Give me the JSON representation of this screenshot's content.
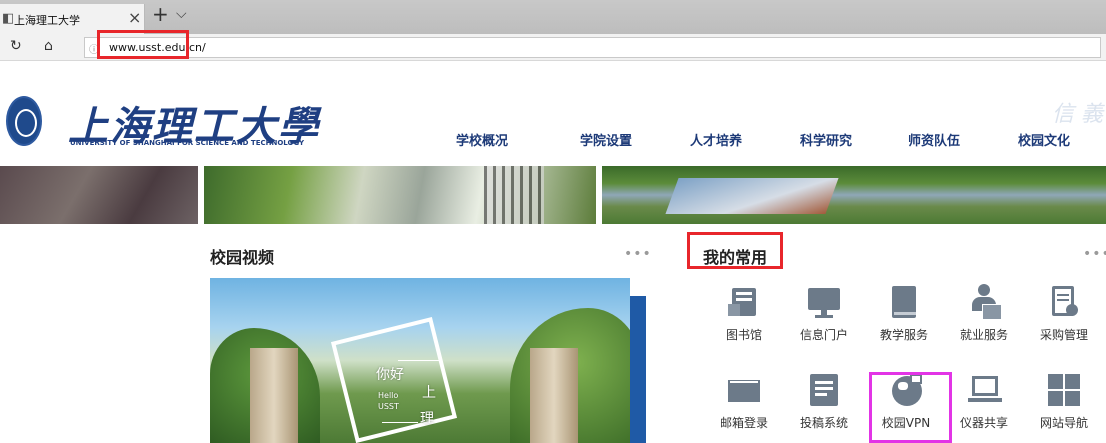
{
  "browser": {
    "tab_title": "上海理工大学",
    "url": "www.usst.edu.cn/"
  },
  "header": {
    "logo_cn": "上海理工大學",
    "logo_en": "UNIVERSITY OF SHANGHAI FOR SCIENCE AND TECHNOLOGY",
    "corner_text": "信 義",
    "nav": [
      "学校概况",
      "学院设置",
      "人才培养",
      "科学研究",
      "师资队伍",
      "校园文化"
    ]
  },
  "video_section": {
    "title": "校园视频",
    "more": "•••",
    "overlay": {
      "line1": "你好",
      "line2": "Hello",
      "line3": "USST",
      "line4": "上",
      "line5": "理"
    }
  },
  "favorites_section": {
    "title": "我的常用",
    "more": "•••",
    "items": [
      {
        "label": "图书馆",
        "icon": "library-icon"
      },
      {
        "label": "信息门户",
        "icon": "monitor-icon"
      },
      {
        "label": "教学服务",
        "icon": "book-icon"
      },
      {
        "label": "就业服务",
        "icon": "person-icon"
      },
      {
        "label": "采购管理",
        "icon": "document-gear-icon"
      },
      {
        "label": "邮箱登录",
        "icon": "envelope-icon"
      },
      {
        "label": "投稿系统",
        "icon": "form-icon"
      },
      {
        "label": "校园VPN",
        "icon": "globe-network-icon"
      },
      {
        "label": "仪器共享",
        "icon": "laptop-icon"
      },
      {
        "label": "网站导航",
        "icon": "grid-icon"
      }
    ]
  },
  "colors": {
    "brand_blue": "#1f3f82",
    "highlight_red": "#e8262b",
    "highlight_magenta": "#e234e6",
    "icon_gray": "#6c7a89"
  }
}
